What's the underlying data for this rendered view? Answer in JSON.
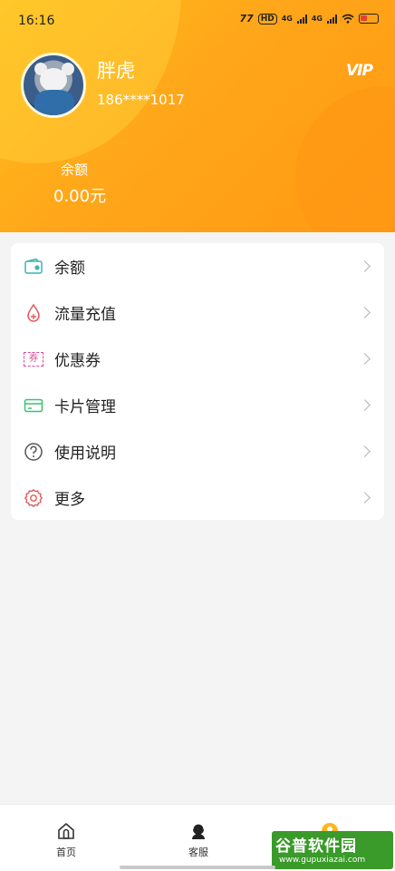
{
  "status_bar": {
    "time": "16:16",
    "carrier_badge": "77",
    "hd_badge": "HD",
    "network_1": "4G",
    "network_2": "4G"
  },
  "profile": {
    "username": "胖虎",
    "phone": "186****1017",
    "vip_badge": "VIP"
  },
  "balance": {
    "label": "余额",
    "value": "0.00元"
  },
  "menu": {
    "items": [
      {
        "label": "余额",
        "icon": "wallet-icon",
        "color": "#3fb4b0"
      },
      {
        "label": "流量充值",
        "icon": "water-drop-icon",
        "color": "#e05a5a"
      },
      {
        "label": "优惠券",
        "icon": "coupon-icon",
        "color": "#e0489a",
        "icon_text": "券"
      },
      {
        "label": "卡片管理",
        "icon": "card-icon",
        "color": "#3fbf73"
      },
      {
        "label": "使用说明",
        "icon": "help-icon",
        "color": "#555555"
      },
      {
        "label": "更多",
        "icon": "settings-icon",
        "color": "#e05a5a"
      }
    ]
  },
  "bottom_nav": {
    "items": [
      {
        "label": "首页",
        "icon": "home-icon"
      },
      {
        "label": "客服",
        "icon": "customer-service-icon"
      },
      {
        "label": "",
        "icon": "profile-icon",
        "active": true
      }
    ]
  },
  "watermark": {
    "brand": "谷普软件园",
    "url": "www.gupuxiazai.com"
  },
  "colors": {
    "header_gradient_start": "#ffbe1b",
    "header_gradient_end": "#ff9a12",
    "page_background": "#f4f4f5"
  }
}
